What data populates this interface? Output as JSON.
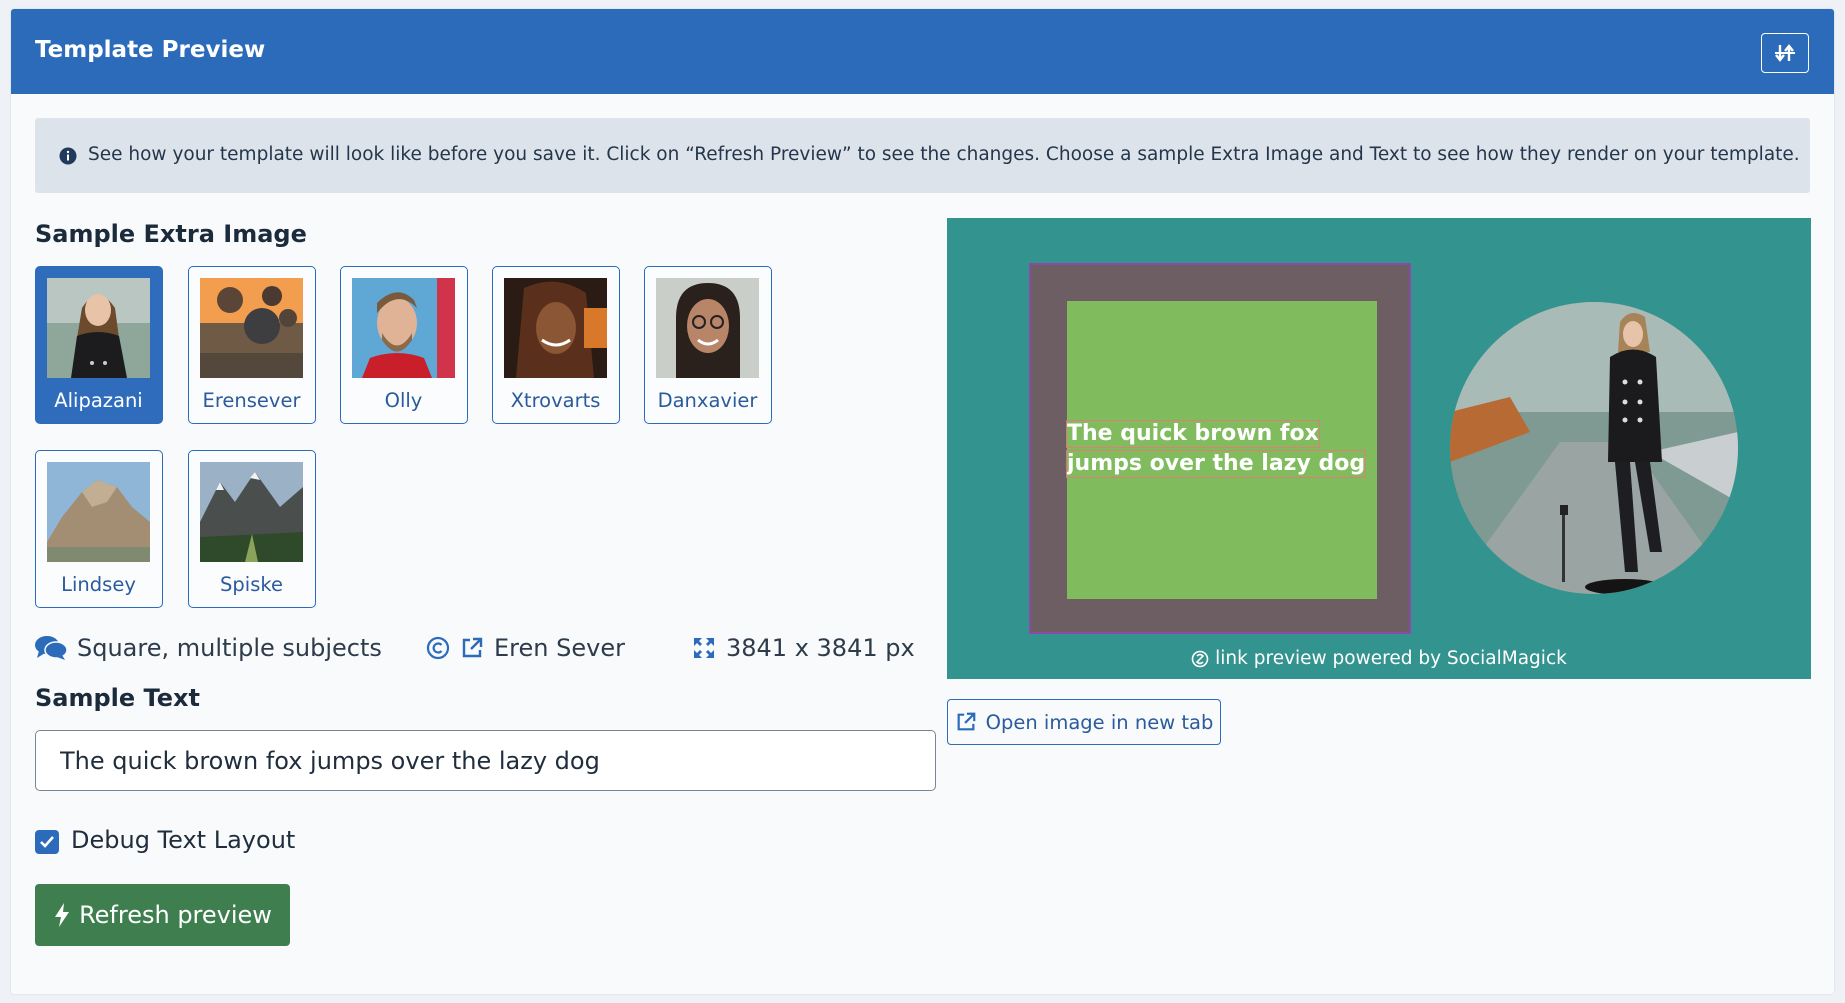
{
  "header": {
    "title": "Template Preview",
    "toggle_icon": "sort-arrows-icon"
  },
  "info": {
    "icon": "info-circle-icon",
    "text": "See how your template will look like before you save it. Click on “Refresh Preview” to see the changes. Choose a sample Extra Image and Text to see how they render on your template."
  },
  "sample_image": {
    "title": "Sample Extra Image",
    "cards": [
      {
        "label": "Alipazani",
        "selected": true
      },
      {
        "label": "Erensever",
        "selected": false
      },
      {
        "label": "Olly",
        "selected": false
      },
      {
        "label": "Xtrovarts",
        "selected": false
      },
      {
        "label": "Danxavier",
        "selected": false
      },
      {
        "label": "Lindsey",
        "selected": false
      },
      {
        "label": "Spiske",
        "selected": false
      }
    ],
    "meta": {
      "description": "Square, multiple subjects",
      "author": "Eren Sever",
      "dimensions": "3841 x 3841 px"
    }
  },
  "sample_text": {
    "title": "Sample Text",
    "value": "The quick brown fox jumps over the lazy dog"
  },
  "debug": {
    "label": "Debug Text Layout",
    "checked": true
  },
  "refresh_button": {
    "label": "Refresh preview"
  },
  "preview": {
    "overlay_lines": [
      "The quick brown fox",
      "jumps over the lazy dog"
    ],
    "powered_by": "link preview powered by SocialMagick",
    "background_color": "#33938f",
    "text_box_color": "#80bb5d"
  },
  "open_button": {
    "label": "Open image in new tab"
  },
  "colors": {
    "header": "#2b6bba",
    "primary": "#2b6bba",
    "success": "#3f7f4f"
  }
}
